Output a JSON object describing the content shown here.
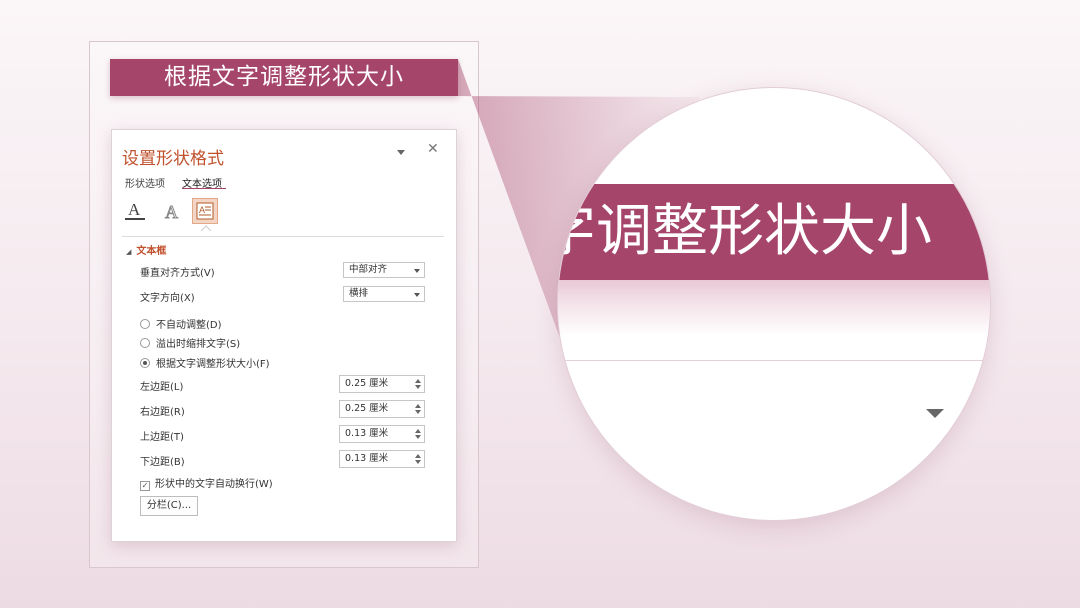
{
  "banner": {
    "title": "根据文字调整形状大小"
  },
  "panel": {
    "title": "设置形状格式",
    "tabs": [
      {
        "label": "形状选项"
      },
      {
        "label": "文本选项"
      }
    ],
    "icons": [
      "text-fill-outline-icon",
      "text-effects-icon",
      "textbox-icon"
    ],
    "section_title": "文本框",
    "vertical_align": {
      "label": "垂直对齐方式(V)",
      "value": "中部对齐"
    },
    "text_direction": {
      "label": "文字方向(X)",
      "value": "横排"
    },
    "autofit_options": [
      {
        "label": "不自动调整(D)",
        "selected": false
      },
      {
        "label": "溢出时缩排文字(S)",
        "selected": false
      },
      {
        "label": "根据文字调整形状大小(F)",
        "selected": true
      }
    ],
    "margins": [
      {
        "label": "左边距(L)",
        "value": "0.25 厘米"
      },
      {
        "label": "右边距(R)",
        "value": "0.25 厘米"
      },
      {
        "label": "上边距(T)",
        "value": "0.13 厘米"
      },
      {
        "label": "下边距(B)",
        "value": "0.13 厘米"
      }
    ],
    "wrap_text": {
      "label": "形状中的文字自动换行(W)",
      "checked": true
    },
    "columns_button": "分栏(C)..."
  },
  "magnifier": {
    "banner_text": "字调整形状大小"
  },
  "colors": {
    "accent": "#a6456a",
    "title_orange": "#c1512d",
    "icon_highlight": "#f3d5c5"
  }
}
